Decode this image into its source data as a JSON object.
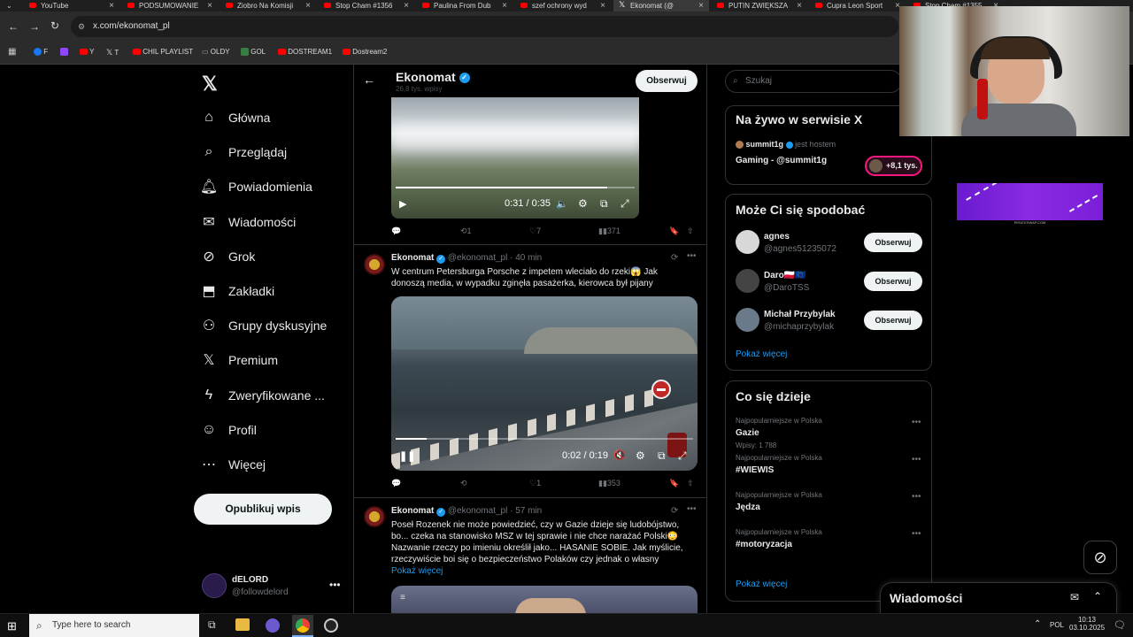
{
  "browser": {
    "tabs": [
      {
        "label": "YouTube",
        "type": "yt"
      },
      {
        "label": "PODSUMOWANIE",
        "type": "yt"
      },
      {
        "label": "Ziobro Na Komisji",
        "type": "yt"
      },
      {
        "label": "Stop Cham #1356",
        "type": "yt"
      },
      {
        "label": "Paulina From Dub",
        "type": "yt"
      },
      {
        "label": "szef ochrony wyd",
        "type": "yt"
      },
      {
        "label": "Ekonomat (@",
        "type": "x"
      },
      {
        "label": "PUTIN ZWIĘKSZA",
        "type": "yt"
      },
      {
        "label": "Cupra Leon Sport",
        "type": "yt"
      },
      {
        "label": "Stop Cham #1355",
        "type": "yt"
      }
    ],
    "url": "x.com/ekonomat_pl",
    "bookmarks": [
      "F",
      "Y",
      "T",
      "CHIL PLAYLIST",
      "OLDY",
      "GOL",
      "DOSTREAM1",
      "Dostream2"
    ]
  },
  "nav": {
    "items": [
      {
        "label": "Główna",
        "icon": "home-icon"
      },
      {
        "label": "Przeglądaj",
        "icon": "search-icon"
      },
      {
        "label": "Powiadomienia",
        "icon": "bell-icon"
      },
      {
        "label": "Wiadomości",
        "icon": "mail-icon"
      },
      {
        "label": "Grok",
        "icon": "grok-icon"
      },
      {
        "label": "Zakładki",
        "icon": "bookmark-icon"
      },
      {
        "label": "Grupy dyskusyjne",
        "icon": "groups-icon"
      },
      {
        "label": "Premium",
        "icon": "x-icon"
      },
      {
        "label": "Zweryfikowane ...",
        "icon": "bolt-icon"
      },
      {
        "label": "Profil",
        "icon": "person-icon"
      },
      {
        "label": "Więcej",
        "icon": "more-icon"
      }
    ],
    "post_button": "Opublikuj wpis",
    "account": {
      "name": "dELORD",
      "handle": "@followdelord"
    }
  },
  "profile_header": {
    "name": "Ekonomat",
    "sub": "26,8 tys. wpisy",
    "follow_label": "Obserwuj"
  },
  "video1": {
    "time": "0:31 / 0:35",
    "progress": 0.886
  },
  "tweet0_actions": {
    "replies": "",
    "reposts": "1",
    "likes": "7",
    "views": "371"
  },
  "tweet1": {
    "name": "Ekonomat",
    "handle": "@ekonomat_pl",
    "time": "· 40 min",
    "text": "W centrum Petersburga Porsche z impetem wleciało do rzeki😱 Jak donoszą media, w wypadku zginęła pasażerka, kierowca był pijany",
    "video_time": "0:02 / 0:19",
    "progress": 0.105,
    "replies": "",
    "reposts": "",
    "likes": "1",
    "views": "353"
  },
  "tweet2": {
    "name": "Ekonomat",
    "handle": "@ekonomat_pl",
    "time": "· 57 min",
    "text": "Poseł Rozenek nie może powiedzieć, czy w Gazie dzieje się ludobójstwo, bo... czeka na stanowisko MSZ w tej sprawie i nie chce narażać Polski😳 Nazwanie rzeczy po imieniu określił jako... HASANIE SOBIE. Jak myślicie, rzeczywiście boi się o bezpieczeństwo Polaków czy jednak o własny",
    "show_more": "Pokaż więcej"
  },
  "search": {
    "placeholder": "Szukaj"
  },
  "live": {
    "title": "Na żywo w serwisie X",
    "host": "summit1g",
    "host_suffix": "jest hostem",
    "space": "Gaming - @summit1g",
    "listeners": "+8,1 tys."
  },
  "who_to_follow": {
    "title": "Może Ci się spodobać",
    "users": [
      {
        "name": "agnes",
        "handle": "@agnes51235072",
        "button": "Obserwuj"
      },
      {
        "name": "Daro🇵🇱🇪🇺",
        "handle": "@DaroTSS",
        "button": "Obserwuj"
      },
      {
        "name": "Michał Przybylak",
        "handle": "@michaprzybylak",
        "button": "Obserwuj"
      }
    ],
    "show_more": "Pokaż więcej"
  },
  "trends": {
    "title": "Co się dzieje",
    "items": [
      {
        "category": "Najpopularniejsze w Polska",
        "name": "Gazie",
        "count": "Wpisy: 1 788"
      },
      {
        "category": "Najpopularniejsze w Polska",
        "name": "#WIEWIS",
        "count": ""
      },
      {
        "category": "Najpopularniejsze w Polska",
        "name": "Jędza",
        "count": ""
      },
      {
        "category": "Najpopularniejsze w Polska",
        "name": "#motoryzacja",
        "count": ""
      }
    ],
    "show_more": "Pokaż więcej"
  },
  "ad": {
    "caption": "PIRATESWAP.COM"
  },
  "messages_drawer": {
    "title": "Wiadomości"
  },
  "taskbar": {
    "search_placeholder": "Type here to search",
    "lang": "POL",
    "time": "10:13",
    "date": "03.10.2025"
  },
  "colors": {
    "accent": "#1d9bf0",
    "bg": "#000000",
    "border": "#2f3336",
    "muted": "#71767b"
  }
}
